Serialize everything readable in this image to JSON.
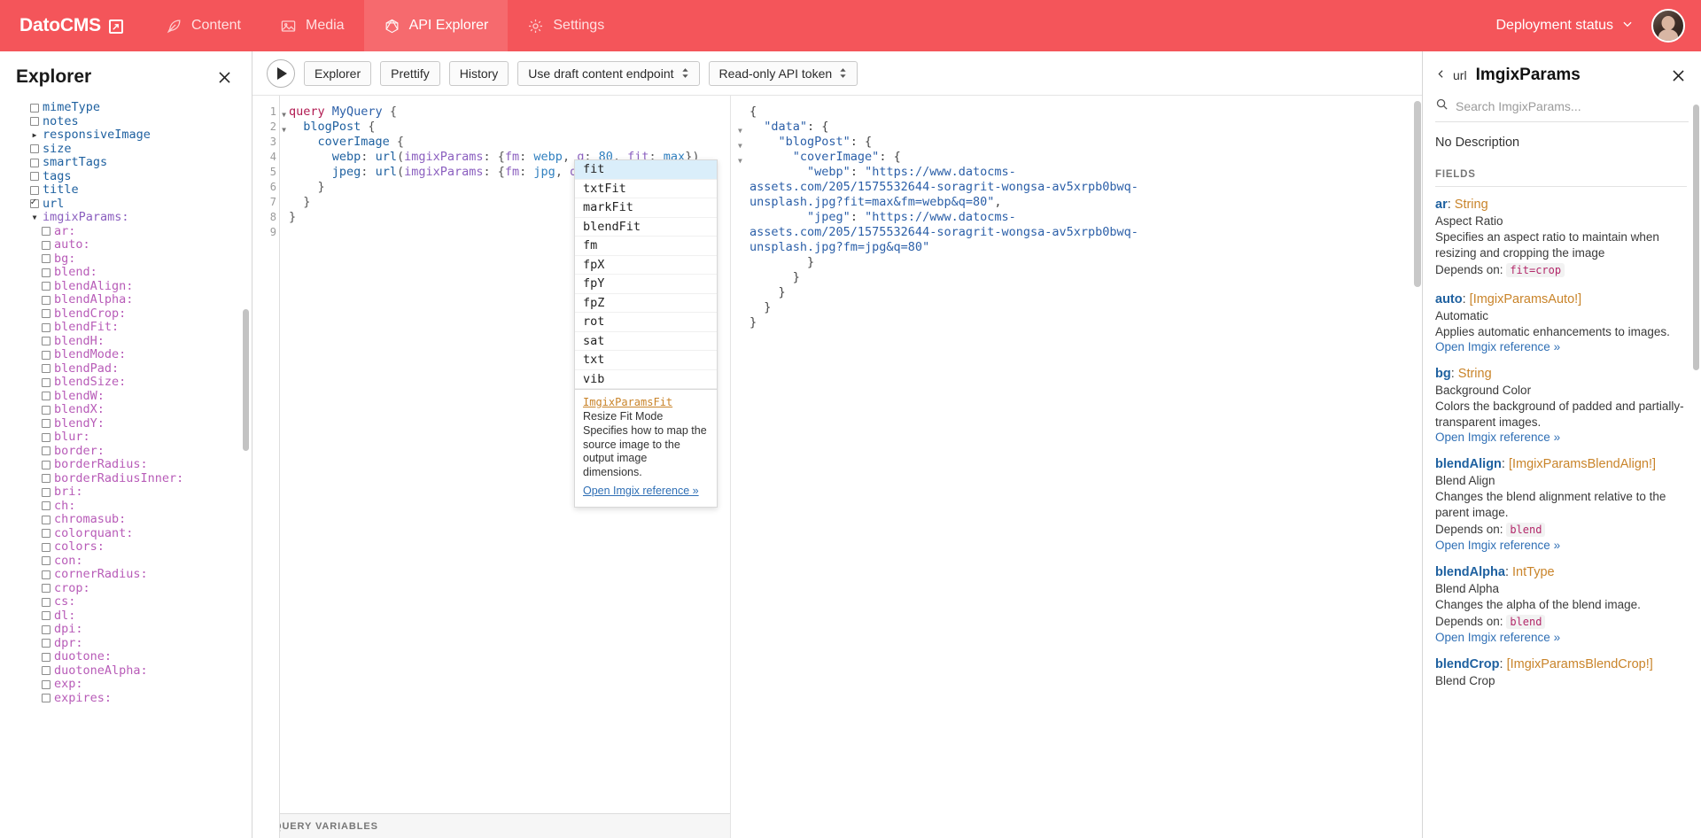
{
  "topbar": {
    "brand": "DatoCMS",
    "brand_icon": "external-link-icon",
    "tabs": [
      {
        "label": "Content",
        "icon": "feather-icon",
        "active": false
      },
      {
        "label": "Media",
        "icon": "image-icon",
        "active": false
      },
      {
        "label": "API Explorer",
        "icon": "graphql-icon",
        "active": true
      },
      {
        "label": "Settings",
        "icon": "gear-icon",
        "active": false
      }
    ],
    "deployment_status": "Deployment status",
    "deployment_caret": "chevron-down-icon",
    "accent_color": "#f4555a",
    "accent_active_color": "#f66a6e"
  },
  "explorer": {
    "title": "Explorer",
    "close_icon": "close-icon",
    "tree": [
      {
        "label": "mimeType",
        "kind": "field",
        "indent": 0,
        "control": "checkbox",
        "checked": false
      },
      {
        "label": "notes",
        "kind": "field",
        "indent": 0,
        "control": "checkbox",
        "checked": false
      },
      {
        "label": "responsiveImage",
        "kind": "field",
        "indent": 0,
        "control": "arrow-right"
      },
      {
        "label": "size",
        "kind": "field",
        "indent": 0,
        "control": "checkbox",
        "checked": false
      },
      {
        "label": "smartTags",
        "kind": "field",
        "indent": 0,
        "control": "checkbox",
        "checked": false
      },
      {
        "label": "tags",
        "kind": "field",
        "indent": 0,
        "control": "checkbox",
        "checked": false
      },
      {
        "label": "title",
        "kind": "field",
        "indent": 0,
        "control": "checkbox",
        "checked": false
      },
      {
        "label": "url",
        "kind": "field",
        "indent": 0,
        "control": "checkbox",
        "checked": true
      },
      {
        "label": "imgixParams:",
        "kind": "arg",
        "indent": 1,
        "control": "arrow-down"
      },
      {
        "label": "ar:",
        "kind": "key",
        "indent": 2,
        "control": "checkbox",
        "checked": false
      },
      {
        "label": "auto:",
        "kind": "key",
        "indent": 2,
        "control": "checkbox",
        "checked": false
      },
      {
        "label": "bg:",
        "kind": "key",
        "indent": 2,
        "control": "checkbox",
        "checked": false
      },
      {
        "label": "blend:",
        "kind": "key",
        "indent": 2,
        "control": "checkbox",
        "checked": false
      },
      {
        "label": "blendAlign:",
        "kind": "key",
        "indent": 2,
        "control": "checkbox",
        "checked": false
      },
      {
        "label": "blendAlpha:",
        "kind": "key",
        "indent": 2,
        "control": "checkbox",
        "checked": false
      },
      {
        "label": "blendCrop:",
        "kind": "key",
        "indent": 2,
        "control": "checkbox",
        "checked": false
      },
      {
        "label": "blendFit:",
        "kind": "key",
        "indent": 2,
        "control": "checkbox",
        "checked": false
      },
      {
        "label": "blendH:",
        "kind": "key",
        "indent": 2,
        "control": "checkbox",
        "checked": false
      },
      {
        "label": "blendMode:",
        "kind": "key",
        "indent": 2,
        "control": "checkbox",
        "checked": false
      },
      {
        "label": "blendPad:",
        "kind": "key",
        "indent": 2,
        "control": "checkbox",
        "checked": false
      },
      {
        "label": "blendSize:",
        "kind": "key",
        "indent": 2,
        "control": "checkbox",
        "checked": false
      },
      {
        "label": "blendW:",
        "kind": "key",
        "indent": 2,
        "control": "checkbox",
        "checked": false
      },
      {
        "label": "blendX:",
        "kind": "key",
        "indent": 2,
        "control": "checkbox",
        "checked": false
      },
      {
        "label": "blendY:",
        "kind": "key",
        "indent": 2,
        "control": "checkbox",
        "checked": false
      },
      {
        "label": "blur:",
        "kind": "key",
        "indent": 2,
        "control": "checkbox",
        "checked": false
      },
      {
        "label": "border:",
        "kind": "key",
        "indent": 2,
        "control": "checkbox",
        "checked": false
      },
      {
        "label": "borderRadius:",
        "kind": "key",
        "indent": 2,
        "control": "checkbox",
        "checked": false
      },
      {
        "label": "borderRadiusInner:",
        "kind": "key",
        "indent": 2,
        "control": "checkbox",
        "checked": false
      },
      {
        "label": "bri:",
        "kind": "key",
        "indent": 2,
        "control": "checkbox",
        "checked": false
      },
      {
        "label": "ch:",
        "kind": "key",
        "indent": 2,
        "control": "checkbox",
        "checked": false
      },
      {
        "label": "chromasub:",
        "kind": "key",
        "indent": 2,
        "control": "checkbox",
        "checked": false
      },
      {
        "label": "colorquant:",
        "kind": "key",
        "indent": 2,
        "control": "checkbox",
        "checked": false
      },
      {
        "label": "colors:",
        "kind": "key",
        "indent": 2,
        "control": "checkbox",
        "checked": false
      },
      {
        "label": "con:",
        "kind": "key",
        "indent": 2,
        "control": "checkbox",
        "checked": false
      },
      {
        "label": "cornerRadius:",
        "kind": "key",
        "indent": 2,
        "control": "checkbox",
        "checked": false
      },
      {
        "label": "crop:",
        "kind": "key",
        "indent": 2,
        "control": "checkbox",
        "checked": false
      },
      {
        "label": "cs:",
        "kind": "key",
        "indent": 2,
        "control": "checkbox",
        "checked": false
      },
      {
        "label": "dl:",
        "kind": "key",
        "indent": 2,
        "control": "checkbox",
        "checked": false
      },
      {
        "label": "dpi:",
        "kind": "key",
        "indent": 2,
        "control": "checkbox",
        "checked": false
      },
      {
        "label": "dpr:",
        "kind": "key",
        "indent": 2,
        "control": "checkbox",
        "checked": false
      },
      {
        "label": "duotone:",
        "kind": "key",
        "indent": 2,
        "control": "checkbox",
        "checked": false
      },
      {
        "label": "duotoneAlpha:",
        "kind": "key",
        "indent": 2,
        "control": "checkbox",
        "checked": false
      },
      {
        "label": "exp:",
        "kind": "key",
        "indent": 2,
        "control": "checkbox",
        "checked": false
      },
      {
        "label": "expires:",
        "kind": "key",
        "indent": 2,
        "control": "checkbox",
        "checked": false
      }
    ]
  },
  "toolbar": {
    "run_icon": "play-icon",
    "explorer_label": "Explorer",
    "prettify_label": "Prettify",
    "history_label": "History",
    "endpoint_select": "Use draft content endpoint",
    "token_select": "Read-only API token"
  },
  "editor": {
    "lines": [
      {
        "n": "1",
        "fold": "down",
        "tokens": [
          {
            "t": "query ",
            "c": "k-query"
          },
          {
            "t": "MyQuery ",
            "c": "k-name"
          },
          {
            "t": "{",
            "c": "k-punc"
          }
        ]
      },
      {
        "n": "2",
        "fold": "down",
        "tokens": [
          {
            "t": "  ",
            "c": "k-punc"
          },
          {
            "t": "blogPost",
            "c": "k-field"
          },
          {
            "t": " {",
            "c": "k-punc"
          }
        ]
      },
      {
        "n": "3",
        "fold": "",
        "tokens": [
          {
            "t": "    ",
            "c": "k-punc"
          },
          {
            "t": "coverImage",
            "c": "k-field"
          },
          {
            "t": " {",
            "c": "k-punc"
          }
        ]
      },
      {
        "n": "4",
        "fold": "",
        "tokens": [
          {
            "t": "      ",
            "c": "k-punc"
          },
          {
            "t": "webp",
            "c": "k-field"
          },
          {
            "t": ": ",
            "c": "k-punc"
          },
          {
            "t": "url",
            "c": "k-field"
          },
          {
            "t": "(",
            "c": "k-punc"
          },
          {
            "t": "imgixParams",
            "c": "k-arg"
          },
          {
            "t": ": {",
            "c": "k-punc"
          },
          {
            "t": "fm",
            "c": "k-arg"
          },
          {
            "t": ": ",
            "c": "k-punc"
          },
          {
            "t": "webp",
            "c": "k-enum"
          },
          {
            "t": ", ",
            "c": "k-punc"
          },
          {
            "t": "q",
            "c": "k-arg"
          },
          {
            "t": ": ",
            "c": "k-punc"
          },
          {
            "t": "80",
            "c": "k-num"
          },
          {
            "t": ", ",
            "c": "k-punc"
          },
          {
            "t": "fit",
            "c": "k-arg"
          },
          {
            "t": ": ",
            "c": "k-punc"
          },
          {
            "t": "max",
            "c": "k-enum"
          },
          {
            "t": "})",
            "c": "k-punc"
          }
        ]
      },
      {
        "n": "5",
        "fold": "",
        "tokens": [
          {
            "t": "      ",
            "c": "k-punc"
          },
          {
            "t": "jpeg",
            "c": "k-field"
          },
          {
            "t": ": ",
            "c": "k-punc"
          },
          {
            "t": "url",
            "c": "k-field"
          },
          {
            "t": "(",
            "c": "k-punc"
          },
          {
            "t": "imgixParams",
            "c": "k-arg"
          },
          {
            "t": ": {",
            "c": "k-punc"
          },
          {
            "t": "fm",
            "c": "k-arg"
          },
          {
            "t": ": ",
            "c": "k-punc"
          },
          {
            "t": "jpg",
            "c": "k-enum"
          },
          {
            "t": ", ",
            "c": "k-punc"
          },
          {
            "t": "q",
            "c": "k-arg"
          },
          {
            "t": ": ",
            "c": "k-punc"
          },
          {
            "t": "80",
            "c": "k-num"
          },
          {
            "t": "})",
            "c": "k-punc"
          }
        ]
      },
      {
        "n": "6",
        "fold": "",
        "tokens": [
          {
            "t": "    }",
            "c": "k-punc"
          }
        ]
      },
      {
        "n": "7",
        "fold": "",
        "tokens": [
          {
            "t": "  }",
            "c": "k-punc"
          }
        ]
      },
      {
        "n": "8",
        "fold": "",
        "tokens": [
          {
            "t": "}",
            "c": "k-punc"
          }
        ]
      },
      {
        "n": "9",
        "fold": "",
        "tokens": [
          {
            "t": "",
            "c": "k-punc"
          }
        ]
      }
    ],
    "query_variables_label": "QUERY VARIABLES"
  },
  "autocomplete": {
    "items": [
      "fit",
      "txtFit",
      "markFit",
      "blendFit",
      "fm",
      "fpX",
      "fpY",
      "fpZ",
      "rot",
      "sat",
      "txt",
      "vib"
    ],
    "selected": "fit",
    "doc": {
      "type": "ImgixParamsFit",
      "subtitle": "Resize Fit Mode",
      "description": "Specifies how to map the source image to the output image dimensions.",
      "link": "Open Imgix reference »"
    }
  },
  "result": {
    "lines": [
      {
        "fold": "",
        "tokens": [
          {
            "t": "{",
            "c": "rpunc"
          }
        ]
      },
      {
        "fold": "down",
        "tokens": [
          {
            "t": "  ",
            "c": "rpunc"
          },
          {
            "t": "\"data\"",
            "c": "rkey"
          },
          {
            "t": ": {",
            "c": "rpunc"
          }
        ]
      },
      {
        "fold": "down",
        "tokens": [
          {
            "t": "    ",
            "c": "rpunc"
          },
          {
            "t": "\"blogPost\"",
            "c": "rkey"
          },
          {
            "t": ": {",
            "c": "rpunc"
          }
        ]
      },
      {
        "fold": "down",
        "tokens": [
          {
            "t": "      ",
            "c": "rpunc"
          },
          {
            "t": "\"coverImage\"",
            "c": "rkey"
          },
          {
            "t": ": {",
            "c": "rpunc"
          }
        ]
      },
      {
        "fold": "",
        "tokens": [
          {
            "t": "        ",
            "c": "rpunc"
          },
          {
            "t": "\"webp\"",
            "c": "rkey"
          },
          {
            "t": ": ",
            "c": "rpunc"
          },
          {
            "t": "\"https://www.datocms-",
            "c": "rstr"
          }
        ]
      },
      {
        "fold": "",
        "tokens": [
          {
            "t": "assets.com/205/1575532644-soragrit-wongsa-av5xrpb0bwq-",
            "c": "rstr"
          }
        ]
      },
      {
        "fold": "",
        "tokens": [
          {
            "t": "unsplash.jpg?fit=max&fm=webp&q=80\"",
            "c": "rstr"
          },
          {
            "t": ",",
            "c": "rpunc"
          }
        ]
      },
      {
        "fold": "",
        "tokens": [
          {
            "t": "        ",
            "c": "rpunc"
          },
          {
            "t": "\"jpeg\"",
            "c": "rkey"
          },
          {
            "t": ": ",
            "c": "rpunc"
          },
          {
            "t": "\"https://www.datocms-",
            "c": "rstr"
          }
        ]
      },
      {
        "fold": "",
        "tokens": [
          {
            "t": "assets.com/205/1575532644-soragrit-wongsa-av5xrpb0bwq-",
            "c": "rstr"
          }
        ]
      },
      {
        "fold": "",
        "tokens": [
          {
            "t": "unsplash.jpg?fm=jpg&q=80\"",
            "c": "rstr"
          }
        ]
      },
      {
        "fold": "",
        "tokens": [
          {
            "t": "        }",
            "c": "rpunc"
          }
        ]
      },
      {
        "fold": "",
        "tokens": [
          {
            "t": "      }",
            "c": "rpunc"
          }
        ]
      },
      {
        "fold": "",
        "tokens": [
          {
            "t": "    }",
            "c": "rpunc"
          }
        ]
      },
      {
        "fold": "",
        "tokens": [
          {
            "t": "  }",
            "c": "rpunc"
          }
        ]
      },
      {
        "fold": "",
        "tokens": [
          {
            "t": "}",
            "c": "rpunc"
          }
        ]
      }
    ]
  },
  "docs": {
    "back_label": "url",
    "back_icon": "chevron-left-icon",
    "title": "ImgixParams",
    "close_icon": "close-icon",
    "search_icon": "search-icon",
    "search_placeholder": "Search ImgixParams...",
    "search_value": "",
    "no_description": "No Description",
    "fields_label": "FIELDS",
    "fields": [
      {
        "name": "ar",
        "type": "String",
        "title": "Aspect Ratio",
        "description": "Specifies an aspect ratio to maintain when resizing and cropping the image",
        "depends_label": "Depends on:",
        "depends_value": "fit=crop",
        "link": ""
      },
      {
        "name": "auto",
        "type": "[ImgixParamsAuto!]",
        "title": "Automatic",
        "description": "Applies automatic enhancements to images.",
        "depends_label": "",
        "depends_value": "",
        "link": "Open Imgix reference »"
      },
      {
        "name": "bg",
        "type": "String",
        "title": "Background Color",
        "description": "Colors the background of padded and partially-transparent images.",
        "depends_label": "",
        "depends_value": "",
        "link": "Open Imgix reference »"
      },
      {
        "name": "blendAlign",
        "type": "[ImgixParamsBlendAlign!]",
        "title": "Blend Align",
        "description": "Changes the blend alignment relative to the parent image.",
        "depends_label": "Depends on:",
        "depends_value": "blend",
        "link": "Open Imgix reference »"
      },
      {
        "name": "blendAlpha",
        "type": "IntType",
        "title": "Blend Alpha",
        "description": "Changes the alpha of the blend image.",
        "depends_label": "Depends on:",
        "depends_value": "blend",
        "link": "Open Imgix reference »"
      },
      {
        "name": "blendCrop",
        "type": "[ImgixParamsBlendCrop!]",
        "title": "Blend Crop",
        "description": "",
        "depends_label": "",
        "depends_value": "",
        "link": ""
      }
    ]
  }
}
